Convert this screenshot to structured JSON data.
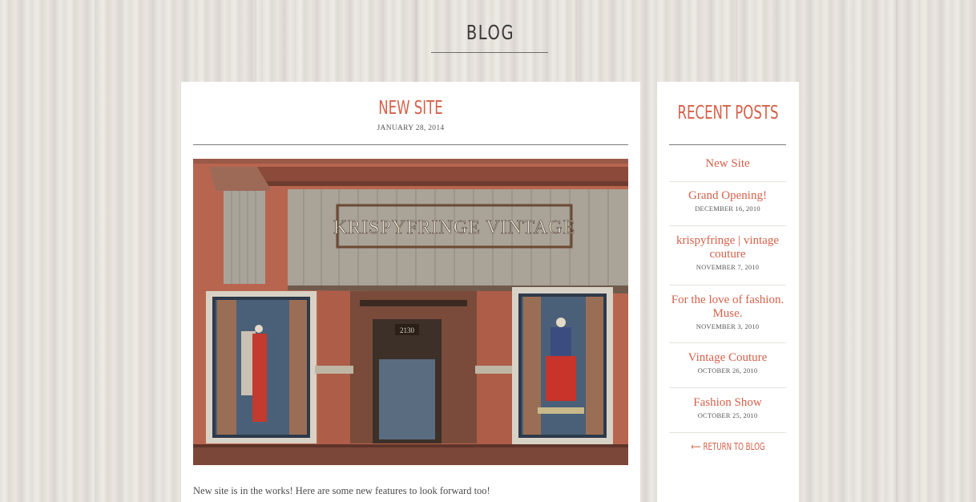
{
  "header": {
    "title": "BLOG"
  },
  "post": {
    "title": "NEW SITE",
    "date": "JANUARY 28, 2014",
    "photo_sign": "KRISPYFRINGE VINTAGE",
    "photo_number": "2130",
    "body": "New site is in the works! Here are some new features to look forward too!"
  },
  "sidebar": {
    "title": "RECENT POSTS",
    "items": [
      {
        "label": "New Site",
        "date": ""
      },
      {
        "label": "Grand Opening!",
        "date": "DECEMBER 16, 2010"
      },
      {
        "label": "krispyfringe | vintage couture",
        "date": "NOVEMBER 7, 2010"
      },
      {
        "label": "For the love of fashion. Muse.",
        "date": "NOVEMBER 3, 2010"
      },
      {
        "label": "Vintage Couture",
        "date": "OCTOBER 26, 2010"
      },
      {
        "label": "Fashion Show",
        "date": "OCTOBER 25, 2010"
      }
    ],
    "back_label": "⟵ RETURN TO BLOG"
  },
  "colors": {
    "accent": "#d4614a",
    "text": "#4a4a4a",
    "card": "#ffffff"
  }
}
